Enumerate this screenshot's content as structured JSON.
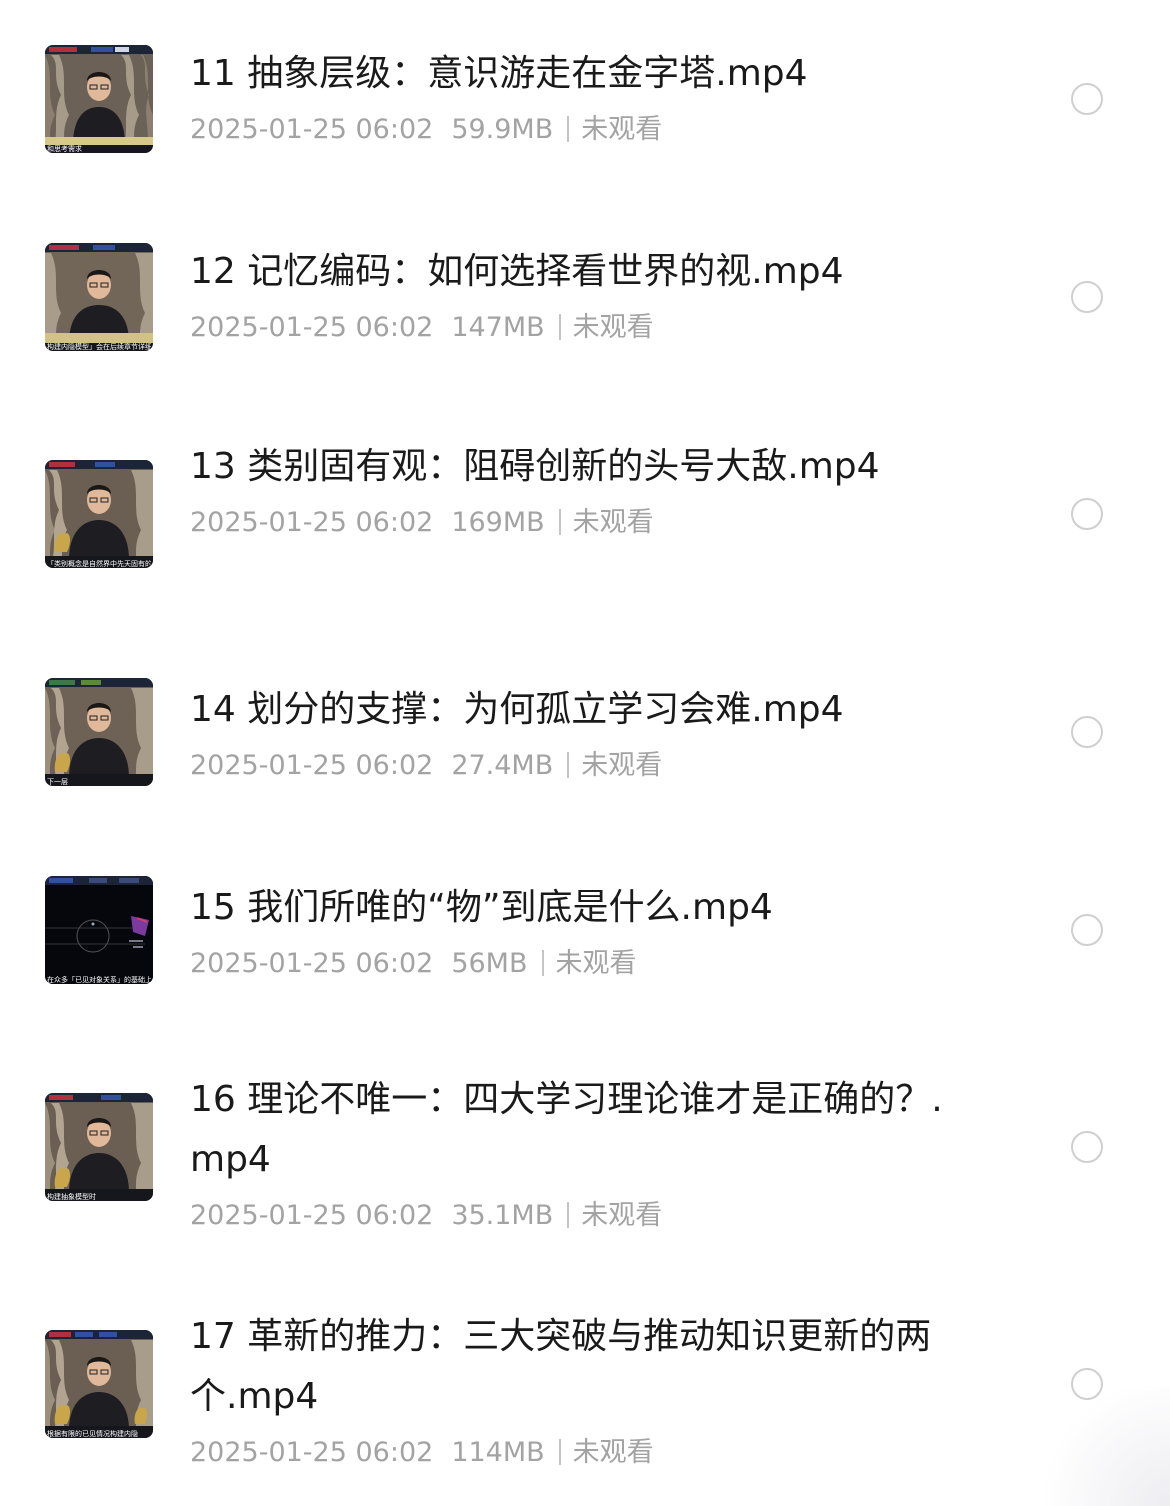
{
  "items": [
    {
      "title": "11 抽象层级：意识游走在金字塔.mp4",
      "date": "2025-01-25 06:02",
      "size": "59.9MB",
      "status": "未观看",
      "thumb_caption": "和思考需求"
    },
    {
      "title": "12 记忆编码：如何选择看世界的视.mp4",
      "date": "2025-01-25 06:02",
      "size": "147MB",
      "status": "未观看",
      "thumb_caption": "构建内隐模型」会在后续章节详细讲"
    },
    {
      "title": "13 类别固有观：阻碍创新的头号大敌.mp4",
      "date": "2025-01-25 06:02",
      "size": "169MB",
      "status": "未观看",
      "thumb_caption": "「类别概念是自然界中先天固有的」"
    },
    {
      "title": "14 划分的支撑：为何孤立学习会难.mp4",
      "date": "2025-01-25 06:02",
      "size": "27.4MB",
      "status": "未观看",
      "thumb_caption": "下一层"
    },
    {
      "title": "15 我们所唯的“物”到底是什么.mp4",
      "date": "2025-01-25 06:02",
      "size": "56MB",
      "status": "未观看",
      "thumb_caption": "在众多「已见对象关系」的基础上"
    },
    {
      "title": "16 理论不唯一：四大学习理论谁才是正确的？.mp4",
      "date": "2025-01-25 06:02",
      "size": "35.1MB",
      "status": "未观看",
      "thumb_caption": "构建抽象模型时"
    },
    {
      "title": "17 革新的推力：三大突破与推动知识更新的两个.mp4",
      "date": "2025-01-25 06:02",
      "size": "114MB",
      "status": "未观看",
      "thumb_caption": "根据有限的已见情况构建内隐"
    }
  ]
}
